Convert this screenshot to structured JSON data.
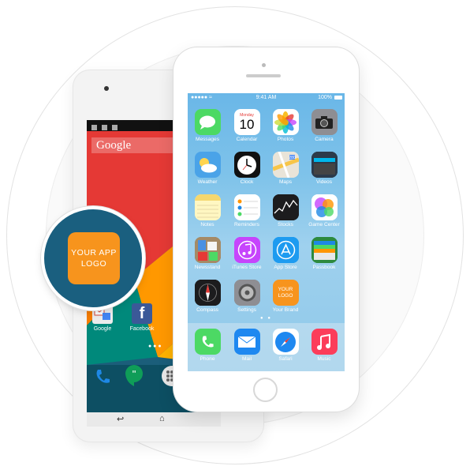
{
  "android": {
    "search_label": "Google",
    "favorites": [
      {
        "label": "Google",
        "icon": "gmail-folder-icon",
        "color": "#f5f5f5"
      },
      {
        "label": "Facebook",
        "icon": "facebook-icon",
        "color": "#3b5998"
      }
    ],
    "dock": [
      {
        "icon": "phone-icon",
        "color": "#1e88e5"
      },
      {
        "icon": "hangouts-icon",
        "color": "#0f9d58"
      },
      {
        "icon": "app-drawer-icon",
        "color": "#e0e0e0"
      }
    ],
    "nav": [
      {
        "icon": "back-icon",
        "glyph": "↩"
      },
      {
        "icon": "home-icon",
        "glyph": "⌂"
      }
    ]
  },
  "badge": {
    "logo_line1": "YOUR APP",
    "logo_line2": "LOGO",
    "color": "#f7941d"
  },
  "iphone": {
    "status": {
      "left": "●●●●● ≈",
      "time": "9:41 AM",
      "battery": "100%"
    },
    "apps": [
      {
        "label": "Messages",
        "icon": "messages-icon",
        "color": "#4cd964"
      },
      {
        "label": "Calendar",
        "icon": "calendar-icon",
        "color": "#ffffff",
        "day": "Monday",
        "date": "10"
      },
      {
        "label": "Photos",
        "icon": "photos-icon",
        "color": "#ffffff"
      },
      {
        "label": "Camera",
        "icon": "camera-icon",
        "color": "#8e8e93"
      },
      {
        "label": "Weather",
        "icon": "weather-icon",
        "color": "#4aa3e8"
      },
      {
        "label": "Clock",
        "icon": "clock-icon",
        "color": "#111111"
      },
      {
        "label": "Maps",
        "icon": "maps-icon",
        "color": "#e9e4d8"
      },
      {
        "label": "Videos",
        "icon": "videos-icon",
        "color": "#2c3a4a"
      },
      {
        "label": "Notes",
        "icon": "notes-icon",
        "color": "#fff3a6"
      },
      {
        "label": "Reminders",
        "icon": "reminders-icon",
        "color": "#ffffff"
      },
      {
        "label": "Stocks",
        "icon": "stocks-icon",
        "color": "#1c1c1e"
      },
      {
        "label": "Game Center",
        "icon": "game-center-icon",
        "color": "#ffffff"
      },
      {
        "label": "Newsstand",
        "icon": "newsstand-icon",
        "color": "#8a6e4b"
      },
      {
        "label": "iTunes Store",
        "icon": "itunes-store-icon",
        "color": "#c644fc"
      },
      {
        "label": "App Store",
        "icon": "app-store-icon",
        "color": "#1d9bf0"
      },
      {
        "label": "Passbook",
        "icon": "passbook-icon",
        "color": "#2d8a3f"
      },
      {
        "label": "Compass",
        "icon": "compass-icon",
        "color": "#1c1c1e"
      },
      {
        "label": "Settings",
        "icon": "settings-icon",
        "color": "#8e8e93"
      },
      {
        "label": "Your Brand",
        "icon": "your-logo-icon",
        "color": "#f7941d",
        "tile_text_1": "YOUR",
        "tile_text_2": "LOGO"
      }
    ],
    "page_dots": "● ●",
    "dock": [
      {
        "label": "Phone",
        "icon": "phone-icon",
        "color": "#4cd964"
      },
      {
        "label": "Mail",
        "icon": "mail-icon",
        "color": "#1e88f0"
      },
      {
        "label": "Safari",
        "icon": "safari-icon",
        "color": "#ffffff"
      },
      {
        "label": "Music",
        "icon": "music-icon",
        "color": "#fc3d5a"
      }
    ]
  }
}
